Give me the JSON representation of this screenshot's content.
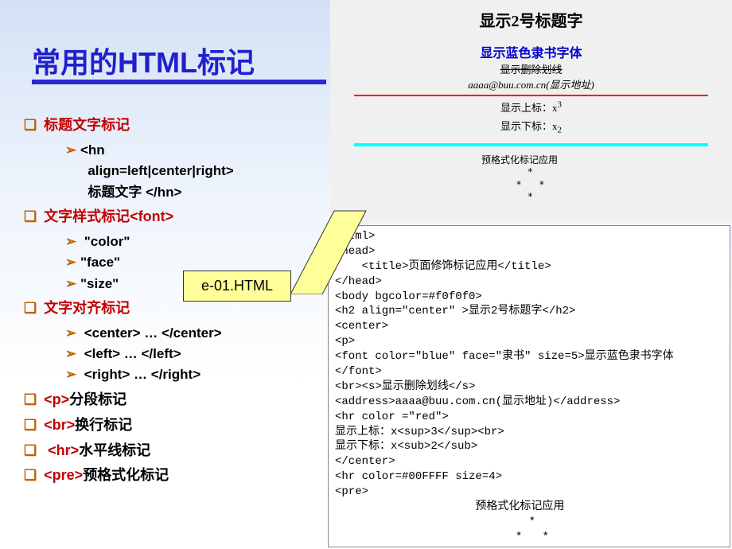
{
  "title": "常用的HTML标记",
  "outline": {
    "item1": "标题文字标记",
    "item1_sub1a": "<hn",
    "item1_sub1b": "align=left|center|right>",
    "item1_sub1c": "标题文字 </hn>",
    "item2_prefix": "文字样式标记",
    "item2_tag": "<font>",
    "item2_sub1": "\"color\"",
    "item2_sub2": "\"face\"",
    "item2_sub3": "\"size\"",
    "item3": "文字对齐标记",
    "item3_sub1": "<center> … </center>",
    "item3_sub2": "<left> … </left>",
    "item3_sub3": "<right> … </right>",
    "item4_tag": "<p>",
    "item4_txt": "分段标记",
    "item5_tag": "<br>",
    "item5_txt": "换行标记",
    "item6_tag": "<hr>",
    "item6_txt": "水平线标记",
    "item7_tag": "<pre>",
    "item7_txt": "预格式化标记"
  },
  "callout": {
    "label": "e-01.HTML"
  },
  "preview": {
    "h2": "显示2号标题字",
    "bluefont": "显示蓝色隶书字体",
    "strike": "显示删除划线",
    "address": "aaaa@buu.com.cn(显示地址)",
    "sup_label": "显示上标：x",
    "sup_val": "3",
    "sub_label": "显示下标：x",
    "sub_val": "2",
    "pre_text": "预格式化标记应用\n        *\n      *   *\n        *"
  },
  "code": "<html>\n<head>\n    <title>页面修饰标记应用</title>\n</head>\n<body bgcolor=#f0f0f0>\n<h2 align=\"center\" >显示2号标题字</h2>\n<center>\n<p>\n<font color=\"blue\" face=\"隶书\" size=5>显示蓝色隶书字体\n</font>\n<br><s>显示删除划线</s>\n<address>aaaa@buu.com.cn(显示地址)</address>\n<hr color =\"red\">\n显示上标：x<sup>3</sup><br>\n显示下标：x<sub>2</sub>\n</center>\n<hr color=#00FFFF size=4>\n<pre>\n                     预格式化标记应用\n                             *\n                           *   *\n                             *\n</pre>\n</body>\n</html>"
}
